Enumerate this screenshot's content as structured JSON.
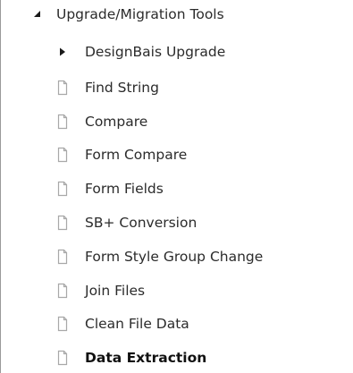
{
  "tree": {
    "root": {
      "label": "Upgrade/Migration Tools",
      "icon": "expanded-triangle-icon",
      "expanded": true
    },
    "children": [
      {
        "label": "DesignBais Upgrade",
        "icon": "collapsed-triangle-icon"
      },
      {
        "label": "Find String",
        "icon": "document-icon"
      },
      {
        "label": "Compare",
        "icon": "document-icon"
      },
      {
        "label": "Form Compare",
        "icon": "document-icon"
      },
      {
        "label": "Form Fields",
        "icon": "document-icon"
      },
      {
        "label": "SB+ Conversion",
        "icon": "document-icon"
      },
      {
        "label": "Form Style Group Change",
        "icon": "document-icon"
      },
      {
        "label": "Join Files",
        "icon": "document-icon"
      },
      {
        "label": "Clean File Data",
        "icon": "document-icon"
      },
      {
        "label": "Data Extraction",
        "icon": "document-icon",
        "selected": true
      }
    ]
  },
  "colors": {
    "text": "#2b2b2b",
    "icon": "#a8a8a8",
    "triangle": "#1a1a1a",
    "border": "#9a9a9a"
  }
}
